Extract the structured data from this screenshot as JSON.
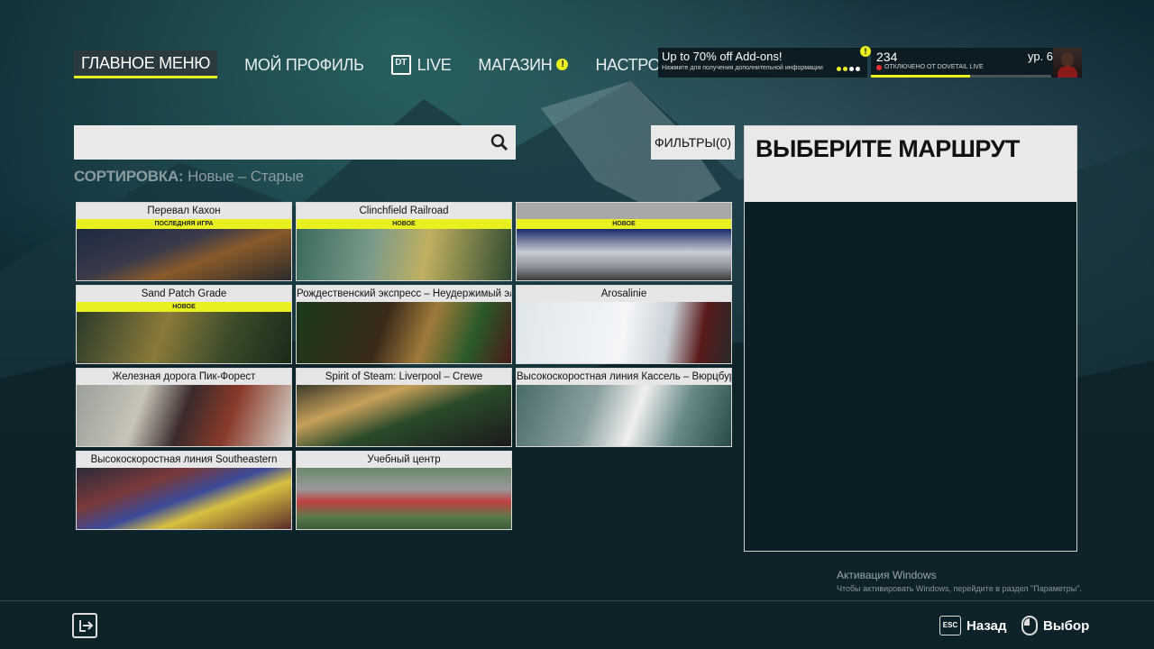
{
  "nav": {
    "items": [
      {
        "label": "ГЛАВНОЕ МЕНЮ",
        "active": true
      },
      {
        "label": "МОЙ ПРОФИЛЬ"
      },
      {
        "label": "LIVE"
      },
      {
        "label": "МАГАЗИН"
      },
      {
        "label": "НАСТРОЙКИ"
      }
    ]
  },
  "promo": {
    "title": "Up to 70% off Add-ons!",
    "subtitle": "Нажмите для получения дополнительной информации"
  },
  "profile": {
    "points": "234",
    "status": "ОТКЛЮЧЕНО ОТ DOVETAIL LIVE",
    "level": "ур. 6",
    "xp_fraction": 0.55
  },
  "search": {
    "placeholder": ""
  },
  "filters_label": "ФИЛЬТРЫ(0)",
  "sort": {
    "label": "СОРТИРОВКА:",
    "value": "Новые – Старые"
  },
  "routes": [
    {
      "title": "Перевал Кахон",
      "badge": "ПОСЛЕДНЯЯ ИГРА"
    },
    {
      "title": "Clinchfield Railroad",
      "badge": "НОВОЕ"
    },
    {
      "title": "",
      "badge": "НОВОЕ"
    },
    {
      "title": "Sand Patch Grade",
      "badge": "НОВОЕ"
    },
    {
      "title": "Рождественский экспресс – Неудержимый эльф",
      "badge": ""
    },
    {
      "title": "Arosalinie",
      "badge": ""
    },
    {
      "title": "Железная дорога Пик-Форест",
      "badge": ""
    },
    {
      "title": "Spirit of Steam: Liverpool – Crewe",
      "badge": ""
    },
    {
      "title": "Высокоскоростная линия Кассель – Вюрцбург",
      "badge": ""
    },
    {
      "title": "Высокоскоростная линия Southeastern",
      "badge": ""
    },
    {
      "title": "Учебный центр",
      "badge": ""
    }
  ],
  "panel": {
    "title": "ВЫБЕРИТЕ МАРШРУТ"
  },
  "watermark": {
    "title": "Активация Windows",
    "text": "Чтобы активировать Windows, перейдите в раздел \"Параметры\"."
  },
  "footer": {
    "back_key": "ESC",
    "back_label": "Назад",
    "select_label": "Выбор"
  },
  "colors": {
    "accent": "#e8f020",
    "panel_bg": "#e9e9e9"
  }
}
